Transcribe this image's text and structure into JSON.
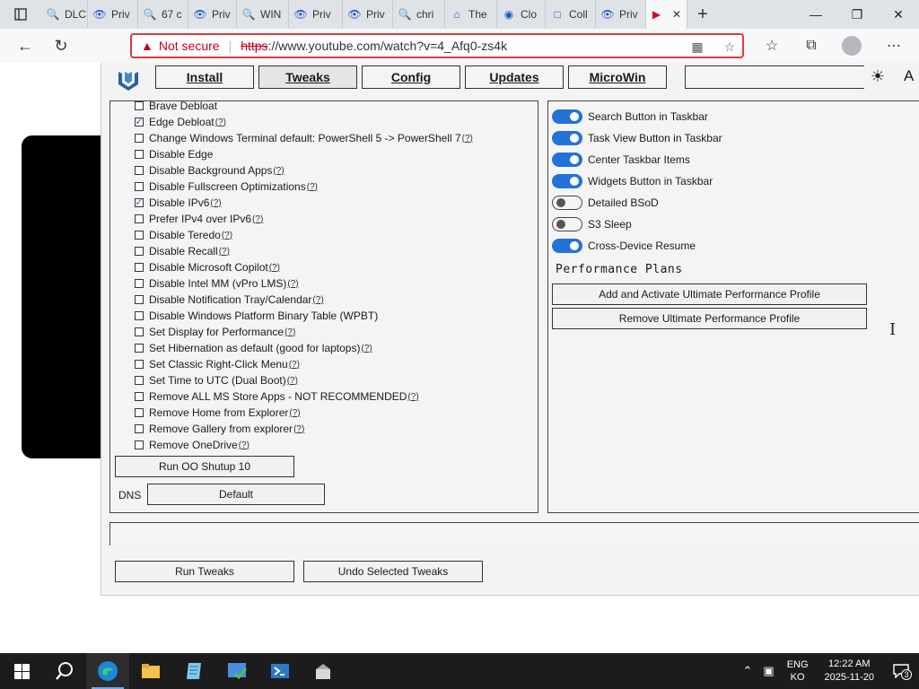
{
  "browser": {
    "tabs": [
      {
        "icon": "search-icon",
        "label": "DLC"
      },
      {
        "icon": "private-tab-icon",
        "label": "Priv"
      },
      {
        "icon": "search-icon",
        "label": "67 c"
      },
      {
        "icon": "private-tab-icon",
        "label": "Priv"
      },
      {
        "icon": "search-icon",
        "label": "WIN"
      },
      {
        "icon": "private-tab-icon",
        "label": "Priv"
      },
      {
        "icon": "private-tab-icon",
        "label": "Priv"
      },
      {
        "icon": "search-icon",
        "label": "chri"
      },
      {
        "icon": "site-icon",
        "label": "The"
      },
      {
        "icon": "shield-icon",
        "label": "Clo"
      },
      {
        "icon": "page-icon",
        "label": "Coll"
      },
      {
        "icon": "private-tab-icon",
        "label": "Priv"
      },
      {
        "icon": "youtube-icon",
        "label": "",
        "active": true
      }
    ],
    "address": {
      "warning": "Not secure",
      "protocol": "https",
      "url_rest": "://www.youtube.com/watch?v=4_Afq0-zs4k"
    }
  },
  "winutil": {
    "nav": [
      "Install",
      "Tweaks",
      "Config",
      "Updates",
      "MicroWin"
    ],
    "active_nav": "Tweaks",
    "search_placeholder": "",
    "left_items": [
      {
        "label": "Brave Debloat",
        "checked": false,
        "help": ""
      },
      {
        "label": "Edge Debloat",
        "checked": true,
        "help": "(?)"
      },
      {
        "label": "Change Windows Terminal default: PowerShell 5 -> PowerShell 7",
        "checked": false,
        "help": "(?)"
      },
      {
        "label": "Disable Edge",
        "checked": false,
        "help": ""
      },
      {
        "label": "Disable Background Apps",
        "checked": false,
        "help": "(?)"
      },
      {
        "label": "Disable Fullscreen Optimizations",
        "checked": false,
        "help": "(?)"
      },
      {
        "label": "Disable IPv6",
        "checked": true,
        "help": "(?)"
      },
      {
        "label": "Prefer IPv4 over IPv6",
        "checked": false,
        "help": "(?)"
      },
      {
        "label": "Disable Teredo",
        "checked": false,
        "help": "(?)"
      },
      {
        "label": "Disable Recall",
        "checked": false,
        "help": "(?)"
      },
      {
        "label": "Disable Microsoft Copilot",
        "checked": false,
        "help": "(?)"
      },
      {
        "label": "Disable Intel MM (vPro LMS)",
        "checked": false,
        "help": "(?)"
      },
      {
        "label": "Disable Notification Tray/Calendar",
        "checked": false,
        "help": "(?)"
      },
      {
        "label": "Disable Windows Platform Binary Table (WPBT)",
        "checked": false,
        "help": ""
      },
      {
        "label": "Set Display for Performance",
        "checked": false,
        "help": "(?)"
      },
      {
        "label": "Set Hibernation as default (good for laptops)",
        "checked": false,
        "help": "(?)"
      },
      {
        "label": "Set Classic Right-Click Menu ",
        "checked": false,
        "help": "(?)"
      },
      {
        "label": "Set Time to UTC (Dual Boot)",
        "checked": false,
        "help": "(?)"
      },
      {
        "label": "Remove ALL MS Store Apps - NOT RECOMMENDED",
        "checked": false,
        "help": "(?)"
      },
      {
        "label": "Remove Home from Explorer",
        "checked": false,
        "help": "(?)"
      },
      {
        "label": "Remove Gallery from explorer",
        "checked": false,
        "help": "(?)"
      },
      {
        "label": "Remove OneDrive",
        "checked": false,
        "help": "(?)"
      }
    ],
    "oo_button": "Run OO Shutup 10",
    "dns_label": "DNS",
    "dns_value": "Default",
    "toggles": [
      {
        "label": "Search Button in Taskbar",
        "on": true
      },
      {
        "label": "Task View Button in Taskbar",
        "on": true
      },
      {
        "label": "Center Taskbar Items",
        "on": true
      },
      {
        "label": "Widgets Button in Taskbar",
        "on": true
      },
      {
        "label": "Detailed BSoD",
        "on": false
      },
      {
        "label": "S3 Sleep",
        "on": false
      },
      {
        "label": "Cross-Device Resume",
        "on": true
      }
    ],
    "perf_title": "Performance Plans",
    "perf_add": "Add and Activate Ultimate Performance Profile",
    "perf_remove": "Remove Ultimate Performance Profile",
    "bottom_buttons": [
      "Run Tweaks",
      "Undo Selected Tweaks"
    ]
  },
  "taskbar": {
    "apps": [
      "start-icon",
      "search-icon",
      "edge-icon",
      "file-explorer-icon",
      "notepad-icon",
      "app-icon",
      "powershell-icon",
      "installer-icon"
    ],
    "lang": [
      "ENG",
      "KO"
    ],
    "time": "12:22 AM",
    "date": "2025-11-20",
    "notifications": "3"
  }
}
